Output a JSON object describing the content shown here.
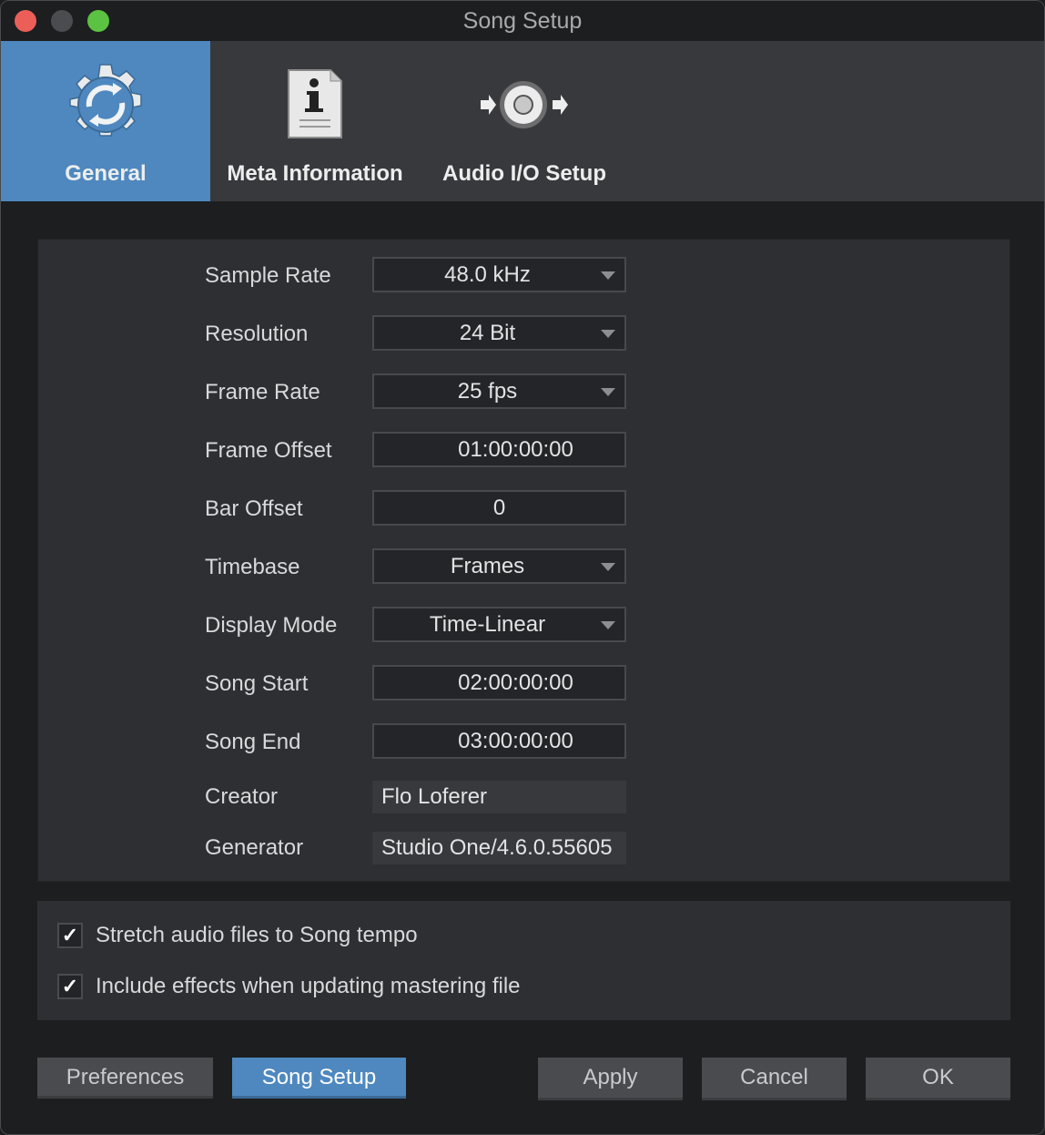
{
  "window": {
    "title": "Song Setup",
    "controls": [
      "close",
      "minimize",
      "zoom"
    ]
  },
  "tabs": [
    {
      "label": "General",
      "icon": "gear-sync-icon",
      "active": true
    },
    {
      "label": "Meta Information",
      "icon": "info-document-icon",
      "active": false
    },
    {
      "label": "Audio I/O Setup",
      "icon": "audio-io-icon",
      "active": false
    }
  ],
  "settings": {
    "sample_rate": {
      "label": "Sample Rate",
      "value": "48.0 kHz"
    },
    "resolution": {
      "label": "Resolution",
      "value": "24 Bit"
    },
    "frame_rate": {
      "label": "Frame Rate",
      "value": "25 fps"
    },
    "frame_offset": {
      "label": "Frame Offset",
      "value": "01:00:00:00"
    },
    "bar_offset": {
      "label": "Bar Offset",
      "value": "0"
    },
    "timebase": {
      "label": "Timebase",
      "value": "Frames"
    },
    "display_mode": {
      "label": "Display Mode",
      "value": "Time-Linear"
    },
    "song_start": {
      "label": "Song Start",
      "value": "02:00:00:00"
    },
    "song_end": {
      "label": "Song End",
      "value": "03:00:00:00"
    },
    "creator": {
      "label": "Creator",
      "value": "Flo Loferer"
    },
    "generator": {
      "label": "Generator",
      "value": "Studio One/4.6.0.55605"
    }
  },
  "options": [
    {
      "label": "Stretch audio files to Song tempo",
      "checked": true,
      "mark": "✓"
    },
    {
      "label": "Include effects when updating mastering file",
      "checked": true,
      "mark": "✓"
    }
  ],
  "buttons": {
    "preferences": "Preferences",
    "song_setup": "Song Setup",
    "apply": "Apply",
    "cancel": "Cancel",
    "ok": "OK"
  },
  "colors": {
    "accent": "#4e88bf",
    "background": "#1d1e20",
    "panel": "#2e2f33"
  }
}
